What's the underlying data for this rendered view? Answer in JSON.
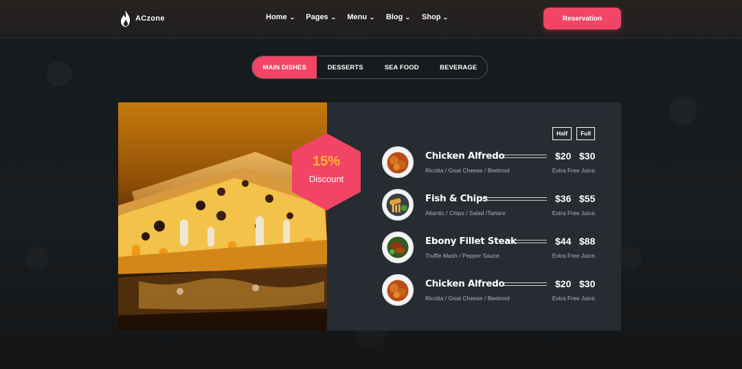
{
  "brand": {
    "name": "ACzone"
  },
  "nav": [
    {
      "label": "Home"
    },
    {
      "label": "Pages"
    },
    {
      "label": "Menu"
    },
    {
      "label": "Blog"
    },
    {
      "label": "Shop"
    }
  ],
  "header": {
    "reservation_label": "Reservation"
  },
  "tabs": [
    {
      "label": "MAIN DISHES",
      "active": true
    },
    {
      "label": "DESSERTS"
    },
    {
      "label": "SEA FOOD"
    },
    {
      "label": "BEVERAGE"
    }
  ],
  "discount": {
    "percent": "15%",
    "label": "Discount"
  },
  "sizes": {
    "half": "Half",
    "full": "Full"
  },
  "menu": [
    {
      "name": "Chicken Alfredo",
      "desc": "Ricotta / Goat Cheese / Beetroot",
      "price_half": "$20",
      "price_full": "$30",
      "extra": "Extra Free Juice.",
      "icon": "fried-chicken-plate"
    },
    {
      "name": "Fish & Chips",
      "desc": "Atlantic / Chips / Salad /Tartare",
      "price_half": "$36",
      "price_full": "$55",
      "extra": "Extra Free Juice.",
      "icon": "fish-and-chips-plate"
    },
    {
      "name": "Ebony Fillet Steak",
      "desc": "Truffle Mash / Pepper Sauce.",
      "price_half": "$44",
      "price_full": "$88",
      "extra": "Extra Free Juice.",
      "icon": "steak-plate"
    },
    {
      "name": "Chicken Alfredo",
      "desc": "Ricotta / Goat Cheese / Beetroot",
      "price_half": "$20",
      "price_full": "$30",
      "extra": "Extra Free Juice.",
      "icon": "fried-chicken-plate"
    }
  ],
  "colors": {
    "accent": "#f24464",
    "discount_text": "#ffb52e",
    "card_bg": "#262c32",
    "page_bg": "#16191b"
  }
}
